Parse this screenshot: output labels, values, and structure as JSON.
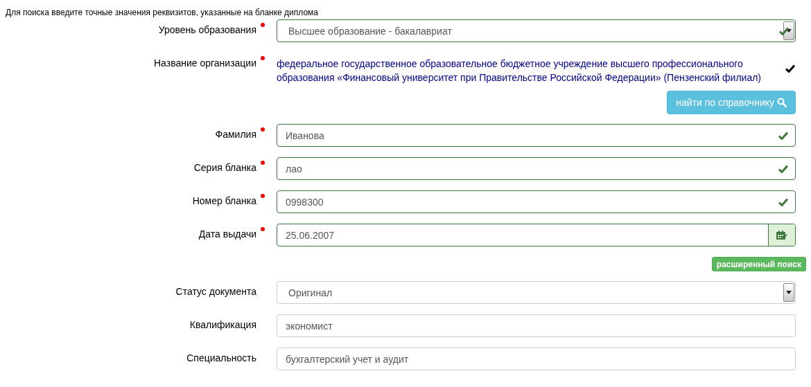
{
  "hint": "Для поиска введите точные значения реквизитов, указанные на бланке диплома",
  "fields": [
    {
      "kind": "select",
      "label": "Уровень образования",
      "required": true,
      "valid": true,
      "value": "Высшее образование - бакалавриат"
    },
    {
      "kind": "org",
      "label": "Название организации",
      "required": true,
      "valid": true,
      "value": "федеральное государственное образовательное бюджетное учреждение высшего профессионального образования «Финансовый университет при Правительстве Российской Федерации» (Пензенский филиал)",
      "button": "найти по справочнику"
    },
    {
      "kind": "input",
      "label": "Фамилия",
      "required": true,
      "valid": true,
      "value": "Иванова"
    },
    {
      "kind": "input",
      "label": "Серия бланка",
      "required": true,
      "valid": true,
      "value": "лао"
    },
    {
      "kind": "input",
      "label": "Номер бланка",
      "required": true,
      "valid": true,
      "value": "0998300"
    },
    {
      "kind": "date",
      "label": "Дата выдачи",
      "required": true,
      "valid": true,
      "value": "25.06.2007"
    }
  ],
  "advanced_search_button": "расширенный поиск",
  "extra_fields": [
    {
      "kind": "select",
      "label": "Статус документа",
      "required": false,
      "valid": false,
      "value": "Оригинал"
    },
    {
      "kind": "input",
      "label": "Квалификация",
      "required": false,
      "valid": false,
      "value": "экономист"
    },
    {
      "kind": "input",
      "label": "Специальность",
      "required": false,
      "valid": false,
      "value": "бухгалтерский учет и аудит"
    }
  ]
}
